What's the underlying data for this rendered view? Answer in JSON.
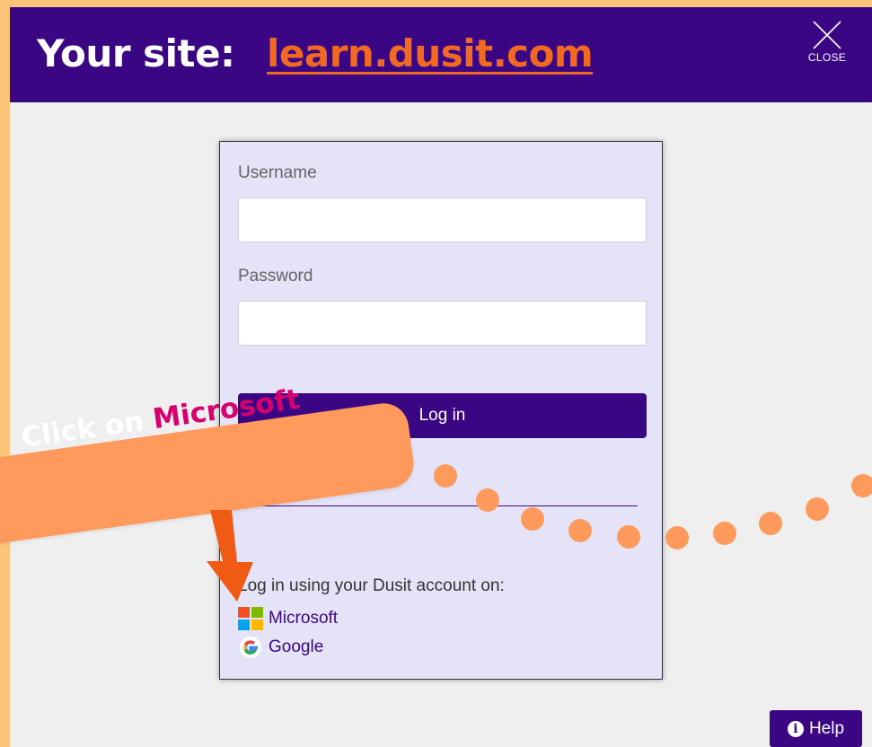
{
  "header": {
    "site_label": "Your site:",
    "site_link": "learn.dusit.com",
    "close_label": "CLOSE"
  },
  "login_form": {
    "username_label": "Username",
    "username_value": "",
    "password_label": "Password",
    "password_value": "",
    "login_button": "Log in",
    "sso_heading": "Log in using your Dusit account on:",
    "sso_providers": [
      {
        "label": "Microsoft",
        "icon": "microsoft-logo-icon"
      },
      {
        "label": "Google",
        "icon": "google-logo-icon"
      }
    ]
  },
  "help": {
    "label": "Help",
    "icon": "info-icon"
  },
  "annotation": {
    "prefix": "Click on",
    "highlight": "Microsoft",
    "arrow_icon": "arrow-down-icon"
  },
  "colors": {
    "page_border": "#fcc57a",
    "header_bg": "#3b0683",
    "link": "#f26a21",
    "card_bg": "#e5e3f7",
    "button_bg": "#3b0683",
    "callout_bg": "#ff9a5c",
    "callout_accent": "#d6006f",
    "dots": "#ff9a5c"
  }
}
